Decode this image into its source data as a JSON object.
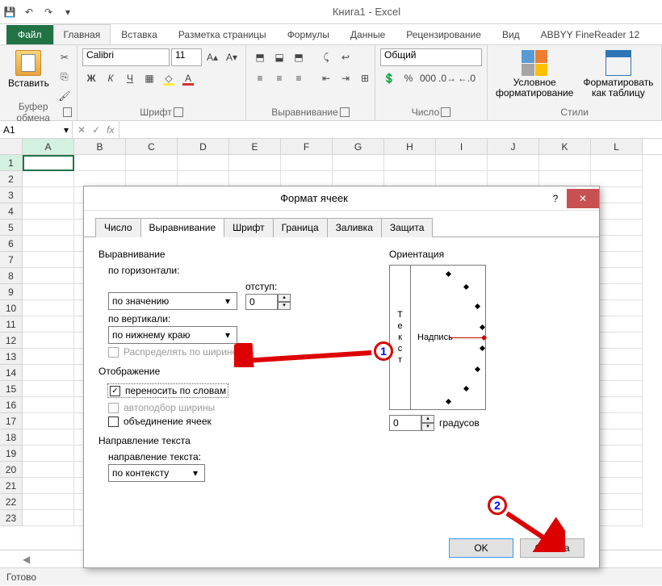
{
  "window": {
    "title": "Книга1 - Excel"
  },
  "tabs": {
    "file": "Файл",
    "items": [
      "Главная",
      "Вставка",
      "Разметка страницы",
      "Формулы",
      "Данные",
      "Рецензирование",
      "Вид",
      "ABBYY FineReader 12"
    ],
    "active": "Главная"
  },
  "ribbon": {
    "clipboard": {
      "label": "Буфер обмена",
      "paste": "Вставить"
    },
    "font": {
      "label": "Шрифт",
      "name": "Calibri",
      "size": "11",
      "bold": "Ж",
      "italic": "К",
      "underline": "Ч"
    },
    "alignment": {
      "label": "Выравнивание"
    },
    "number": {
      "label": "Число",
      "format": "Общий"
    },
    "styles": {
      "label": "Стили",
      "conditional": "Условное\nформатирование",
      "astable": "Форматировать\nкак таблицу"
    }
  },
  "formula": {
    "name_box": "A1"
  },
  "grid": {
    "columns": [
      "A",
      "B",
      "C",
      "D",
      "E",
      "F",
      "G",
      "H",
      "I",
      "J",
      "K",
      "L"
    ],
    "rows": 23
  },
  "dialog": {
    "title": "Формат ячеек",
    "tabs": [
      "Число",
      "Выравнивание",
      "Шрифт",
      "Граница",
      "Заливка",
      "Защита"
    ],
    "active_tab": "Выравнивание",
    "alignment_section": "Выравнивание",
    "horiz_label": "по горизонтали:",
    "horiz_value": "по значению",
    "vert_label": "по вертикали:",
    "vert_value": "по нижнему краю",
    "indent_label": "отступ:",
    "indent_value": "0",
    "distribute": "Распределять по ширине",
    "display_section": "Отображение",
    "wrap": "переносить по словам",
    "shrink": "автоподбор ширины",
    "merge": "объединение ячеек",
    "direction_section": "Направление текста",
    "direction_label": "направление текста:",
    "direction_value": "по контексту",
    "orientation_section": "Ориентация",
    "orient_text": "Текст",
    "orient_label": "Надпись",
    "degrees_value": "0",
    "degrees_label": "градусов",
    "ok": "OK",
    "cancel": "Отмена"
  },
  "status": "Готово"
}
